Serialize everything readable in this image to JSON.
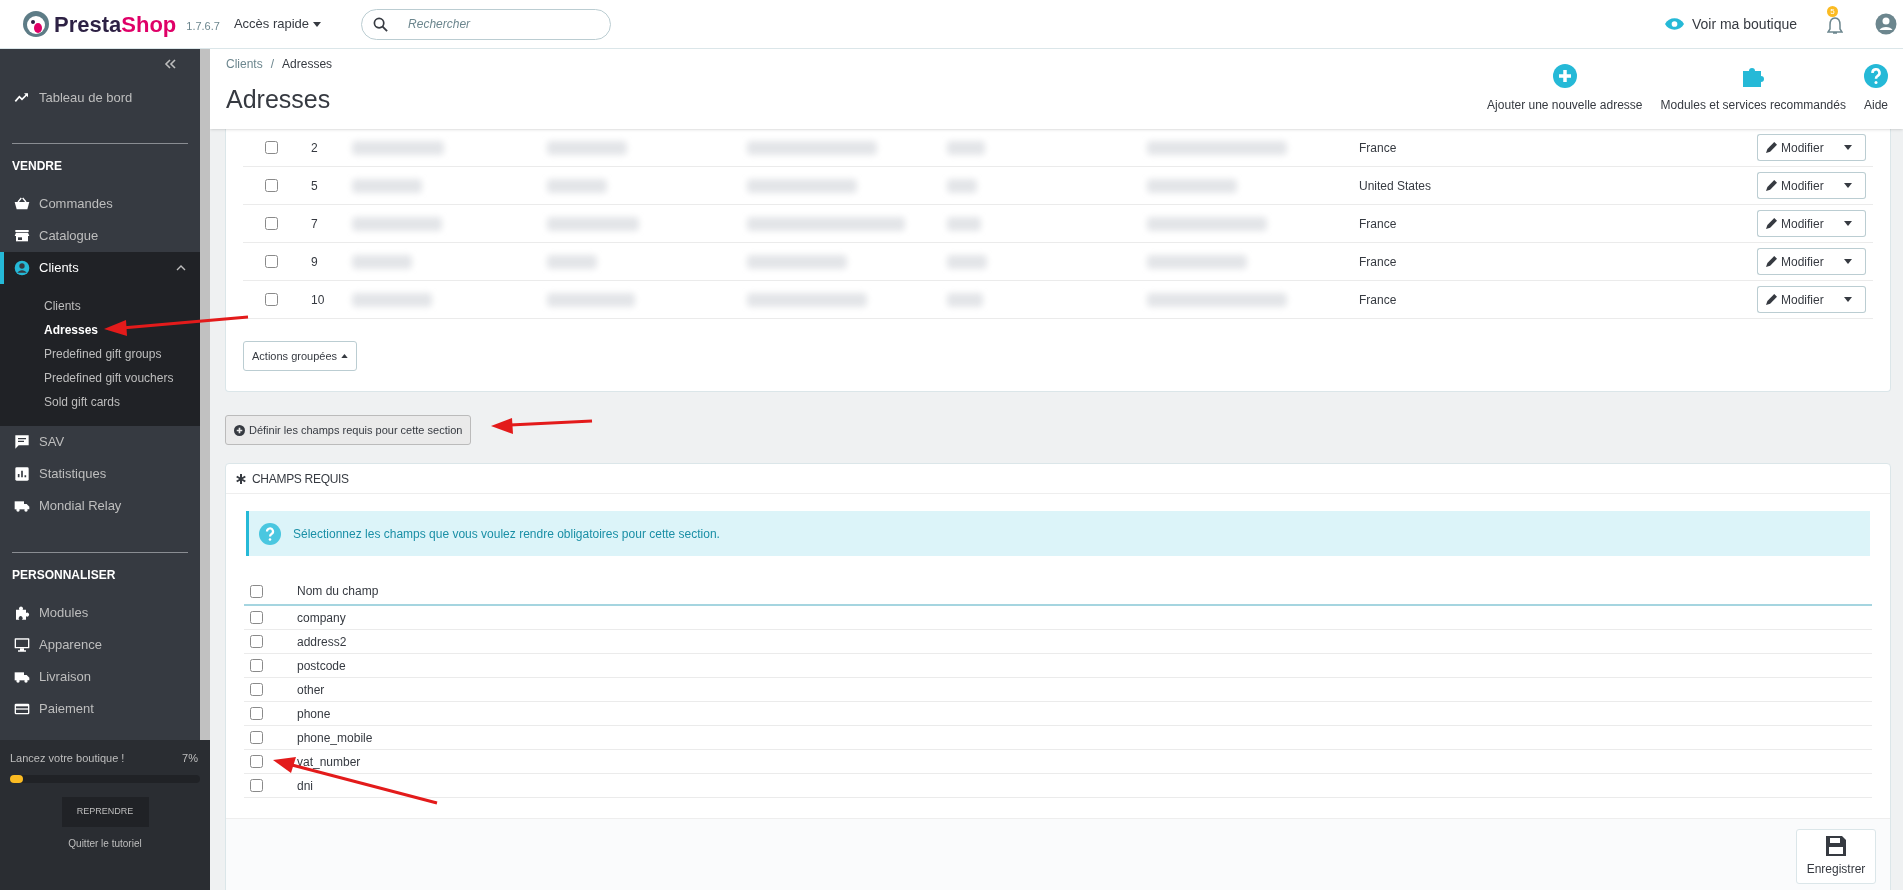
{
  "header": {
    "logo": "PrestaShop",
    "version": "1.7.6.7",
    "quick_access": "Accès rapide",
    "search": {
      "placeholder": "Rechercher"
    },
    "view_shop": "Voir ma boutique",
    "notification_count": "5"
  },
  "sidebar": {
    "sections": [
      {
        "items": [
          {
            "label": "Tableau de bord",
            "selected": false
          }
        ]
      },
      {
        "heading": "VENDRE",
        "items": [
          {
            "label": "Commandes",
            "selected": false
          },
          {
            "label": "Catalogue",
            "selected": false
          },
          {
            "label": "Clients",
            "selected": true,
            "expanded": true,
            "children": [
              {
                "label": "Clients",
                "selected": false
              },
              {
                "label": "Adresses",
                "selected": true
              },
              {
                "label": "Predefined gift groups",
                "selected": false
              },
              {
                "label": "Predefined gift vouchers",
                "selected": false
              },
              {
                "label": "Sold gift cards",
                "selected": false
              }
            ]
          },
          {
            "label": "SAV",
            "selected": false
          },
          {
            "label": "Statistiques",
            "selected": false
          },
          {
            "label": "Mondial Relay",
            "selected": false
          }
        ]
      },
      {
        "heading": "PERSONNALISER",
        "items": [
          {
            "label": "Modules",
            "selected": false
          },
          {
            "label": "Apparence",
            "selected": false
          },
          {
            "label": "Livraison",
            "selected": false
          },
          {
            "label": "Paiement",
            "selected": false
          }
        ]
      }
    ]
  },
  "onboarding": {
    "title": "Lancez votre boutique !",
    "percent": "7%",
    "level": 0.07,
    "resume": "REPRENDRE",
    "quit": "Quitter le tutoriel"
  },
  "breadcrumb": [
    {
      "kind": "link",
      "text": "Clients"
    },
    {
      "kind": "separator",
      "text": "/"
    },
    {
      "kind": "current",
      "text": "Adresses"
    }
  ],
  "title": "Adresses",
  "toolbar": [
    {
      "label": "Ajouter une nouvelle adresse"
    },
    {
      "label": "Modules et services recommandés"
    },
    {
      "label": "Aide"
    }
  ],
  "addresses": {
    "rows": [
      {
        "id": "2",
        "checked": false,
        "country": "France",
        "action": "Modifier"
      },
      {
        "id": "5",
        "checked": false,
        "country": "United States",
        "action": "Modifier"
      },
      {
        "id": "7",
        "checked": false,
        "country": "France",
        "action": "Modifier"
      },
      {
        "id": "9",
        "checked": false,
        "country": "France",
        "action": "Modifier"
      },
      {
        "id": "10",
        "checked": false,
        "country": "France",
        "action": "Modifier"
      }
    ],
    "bulk_actions": "Actions groupées"
  },
  "required_fields_toggle": "Définir les champs requis pour cette section",
  "required_fields": {
    "title": "CHAMPS REQUIS",
    "info": "Sélectionnez les champs que vous voulez rendre obligatoires pour cette section.",
    "column": "Nom du champ",
    "select_all": false,
    "rows": [
      {
        "name": "company",
        "checked": false
      },
      {
        "name": "address2",
        "checked": false
      },
      {
        "name": "postcode",
        "checked": false
      },
      {
        "name": "other",
        "checked": false
      },
      {
        "name": "phone",
        "checked": false
      },
      {
        "name": "phone_mobile",
        "checked": false
      },
      {
        "name": "vat_number",
        "checked": false
      },
      {
        "name": "dni",
        "checked": false
      }
    ],
    "save": "Enregistrer"
  }
}
